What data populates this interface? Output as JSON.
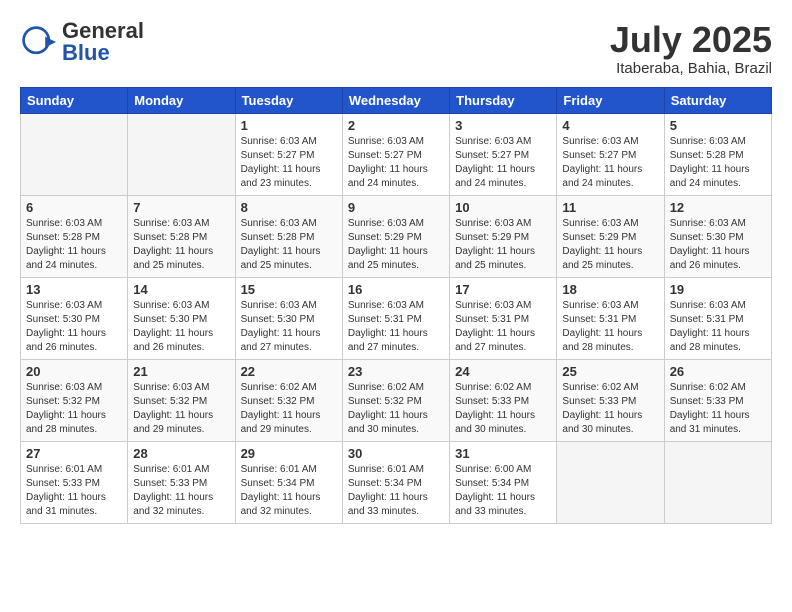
{
  "header": {
    "logo_general": "General",
    "logo_blue": "Blue",
    "month_title": "July 2025",
    "subtitle": "Itaberaba, Bahia, Brazil"
  },
  "weekdays": [
    "Sunday",
    "Monday",
    "Tuesday",
    "Wednesday",
    "Thursday",
    "Friday",
    "Saturday"
  ],
  "weeks": [
    [
      {
        "day": "",
        "info": ""
      },
      {
        "day": "",
        "info": ""
      },
      {
        "day": "1",
        "info": "Sunrise: 6:03 AM\nSunset: 5:27 PM\nDaylight: 11 hours and 23 minutes."
      },
      {
        "day": "2",
        "info": "Sunrise: 6:03 AM\nSunset: 5:27 PM\nDaylight: 11 hours and 24 minutes."
      },
      {
        "day": "3",
        "info": "Sunrise: 6:03 AM\nSunset: 5:27 PM\nDaylight: 11 hours and 24 minutes."
      },
      {
        "day": "4",
        "info": "Sunrise: 6:03 AM\nSunset: 5:27 PM\nDaylight: 11 hours and 24 minutes."
      },
      {
        "day": "5",
        "info": "Sunrise: 6:03 AM\nSunset: 5:28 PM\nDaylight: 11 hours and 24 minutes."
      }
    ],
    [
      {
        "day": "6",
        "info": "Sunrise: 6:03 AM\nSunset: 5:28 PM\nDaylight: 11 hours and 24 minutes."
      },
      {
        "day": "7",
        "info": "Sunrise: 6:03 AM\nSunset: 5:28 PM\nDaylight: 11 hours and 25 minutes."
      },
      {
        "day": "8",
        "info": "Sunrise: 6:03 AM\nSunset: 5:28 PM\nDaylight: 11 hours and 25 minutes."
      },
      {
        "day": "9",
        "info": "Sunrise: 6:03 AM\nSunset: 5:29 PM\nDaylight: 11 hours and 25 minutes."
      },
      {
        "day": "10",
        "info": "Sunrise: 6:03 AM\nSunset: 5:29 PM\nDaylight: 11 hours and 25 minutes."
      },
      {
        "day": "11",
        "info": "Sunrise: 6:03 AM\nSunset: 5:29 PM\nDaylight: 11 hours and 25 minutes."
      },
      {
        "day": "12",
        "info": "Sunrise: 6:03 AM\nSunset: 5:30 PM\nDaylight: 11 hours and 26 minutes."
      }
    ],
    [
      {
        "day": "13",
        "info": "Sunrise: 6:03 AM\nSunset: 5:30 PM\nDaylight: 11 hours and 26 minutes."
      },
      {
        "day": "14",
        "info": "Sunrise: 6:03 AM\nSunset: 5:30 PM\nDaylight: 11 hours and 26 minutes."
      },
      {
        "day": "15",
        "info": "Sunrise: 6:03 AM\nSunset: 5:30 PM\nDaylight: 11 hours and 27 minutes."
      },
      {
        "day": "16",
        "info": "Sunrise: 6:03 AM\nSunset: 5:31 PM\nDaylight: 11 hours and 27 minutes."
      },
      {
        "day": "17",
        "info": "Sunrise: 6:03 AM\nSunset: 5:31 PM\nDaylight: 11 hours and 27 minutes."
      },
      {
        "day": "18",
        "info": "Sunrise: 6:03 AM\nSunset: 5:31 PM\nDaylight: 11 hours and 28 minutes."
      },
      {
        "day": "19",
        "info": "Sunrise: 6:03 AM\nSunset: 5:31 PM\nDaylight: 11 hours and 28 minutes."
      }
    ],
    [
      {
        "day": "20",
        "info": "Sunrise: 6:03 AM\nSunset: 5:32 PM\nDaylight: 11 hours and 28 minutes."
      },
      {
        "day": "21",
        "info": "Sunrise: 6:03 AM\nSunset: 5:32 PM\nDaylight: 11 hours and 29 minutes."
      },
      {
        "day": "22",
        "info": "Sunrise: 6:02 AM\nSunset: 5:32 PM\nDaylight: 11 hours and 29 minutes."
      },
      {
        "day": "23",
        "info": "Sunrise: 6:02 AM\nSunset: 5:32 PM\nDaylight: 11 hours and 30 minutes."
      },
      {
        "day": "24",
        "info": "Sunrise: 6:02 AM\nSunset: 5:33 PM\nDaylight: 11 hours and 30 minutes."
      },
      {
        "day": "25",
        "info": "Sunrise: 6:02 AM\nSunset: 5:33 PM\nDaylight: 11 hours and 30 minutes."
      },
      {
        "day": "26",
        "info": "Sunrise: 6:02 AM\nSunset: 5:33 PM\nDaylight: 11 hours and 31 minutes."
      }
    ],
    [
      {
        "day": "27",
        "info": "Sunrise: 6:01 AM\nSunset: 5:33 PM\nDaylight: 11 hours and 31 minutes."
      },
      {
        "day": "28",
        "info": "Sunrise: 6:01 AM\nSunset: 5:33 PM\nDaylight: 11 hours and 32 minutes."
      },
      {
        "day": "29",
        "info": "Sunrise: 6:01 AM\nSunset: 5:34 PM\nDaylight: 11 hours and 32 minutes."
      },
      {
        "day": "30",
        "info": "Sunrise: 6:01 AM\nSunset: 5:34 PM\nDaylight: 11 hours and 33 minutes."
      },
      {
        "day": "31",
        "info": "Sunrise: 6:00 AM\nSunset: 5:34 PM\nDaylight: 11 hours and 33 minutes."
      },
      {
        "day": "",
        "info": ""
      },
      {
        "day": "",
        "info": ""
      }
    ]
  ]
}
